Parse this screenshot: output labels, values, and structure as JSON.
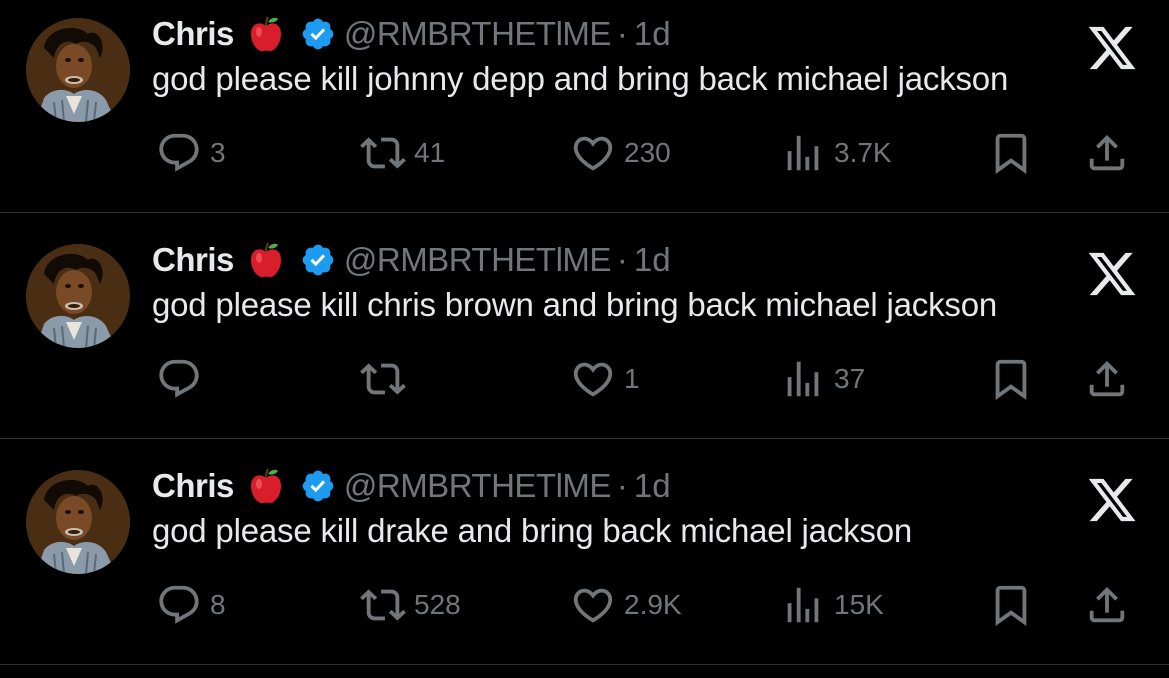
{
  "tweets": [
    {
      "name": "Chris",
      "handle": "@RMBRTHETlME",
      "separator": "·",
      "time": "1d",
      "text": "god please kill johnny depp and bring back michael jackson",
      "replies": "3",
      "reposts": "41",
      "likes": "230",
      "views": "3.7K"
    },
    {
      "name": "Chris",
      "handle": "@RMBRTHETlME",
      "separator": "·",
      "time": "1d",
      "text": "god please kill chris brown and bring back michael jackson",
      "replies": "",
      "reposts": "",
      "likes": "1",
      "views": "37"
    },
    {
      "name": "Chris",
      "handle": "@RMBRTHETlME",
      "separator": "·",
      "time": "1d",
      "text": "god please kill drake and bring back michael jackson",
      "replies": "8",
      "reposts": "528",
      "likes": "2.9K",
      "views": "15K"
    }
  ],
  "icons": {
    "emoji": "red-apple-icon",
    "badge": "verified-badge-icon",
    "brand": "x-logo-icon",
    "reply": "reply-icon",
    "repost": "repost-icon",
    "like": "heart-icon",
    "views": "views-icon",
    "bookmark": "bookmark-icon",
    "share": "share-icon"
  },
  "colors": {
    "background": "#000000",
    "text": "#e7e9ea",
    "secondary": "#71767b",
    "verified": "#1d9bf0",
    "divider": "#2f3336"
  }
}
